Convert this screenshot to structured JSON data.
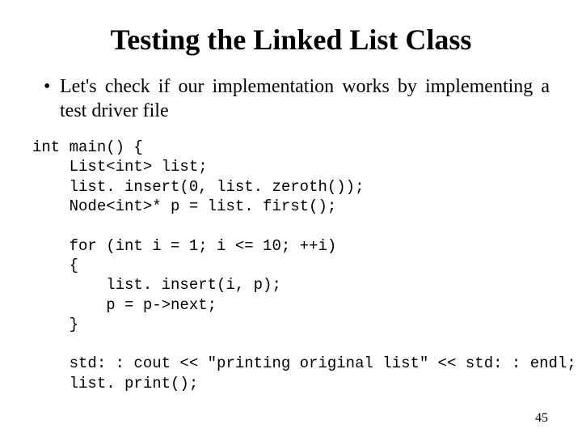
{
  "title": "Testing the Linked List Class",
  "bullet": "Let's check if our implementation works by implementing a test driver file",
  "code": "int main() {\n    List<int> list;\n    list. insert(0, list. zeroth());\n    Node<int>* p = list. first();\n\n    for (int i = 1; i <= 10; ++i)\n    {\n        list. insert(i, p);\n        p = p->next;\n    }\n\n    std: : cout << \"printing original list\" << std: : endl;\n    list. print();",
  "page_number": "45"
}
